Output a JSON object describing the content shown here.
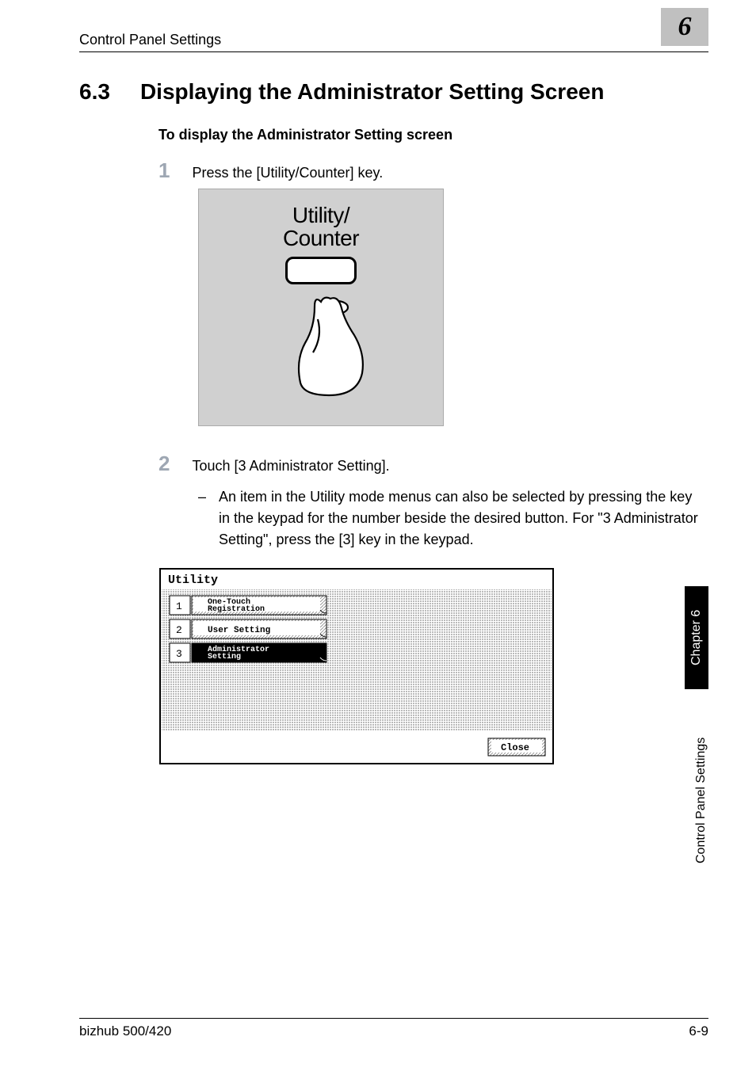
{
  "header": {
    "section": "Control Panel Settings"
  },
  "chapter": {
    "badge": "6"
  },
  "title": {
    "number": "6.3",
    "heading": "Displaying the Administrator Setting Screen"
  },
  "subheading": "To display the Administrator Setting screen",
  "step1": {
    "num": "1",
    "text": "Press the [Utility/Counter] key."
  },
  "illustration1": {
    "line1": "Utility/",
    "line2": "Counter"
  },
  "step2": {
    "num": "2",
    "text": "Touch [3 Administrator Setting].",
    "detail": "An item in the Utility mode menus can also be selected by pressing the key in the keypad for the number beside the desired button. For \"3 Administrator Setting\", press the [3] key in the keypad.",
    "bullet": "–"
  },
  "utility_screen": {
    "title": "Utility",
    "items": [
      {
        "num": "1",
        "label_l1": "One-Touch",
        "label_l2": "Registration"
      },
      {
        "num": "2",
        "label_l1": "User Setting",
        "label_l2": ""
      },
      {
        "num": "3",
        "label_l1": "Administrator",
        "label_l2": "Setting"
      }
    ],
    "close": "Close"
  },
  "sidebar": {
    "chapter": "Chapter 6",
    "section": "Control Panel Settings"
  },
  "footer": {
    "left": "bizhub 500/420",
    "right": "6-9"
  }
}
